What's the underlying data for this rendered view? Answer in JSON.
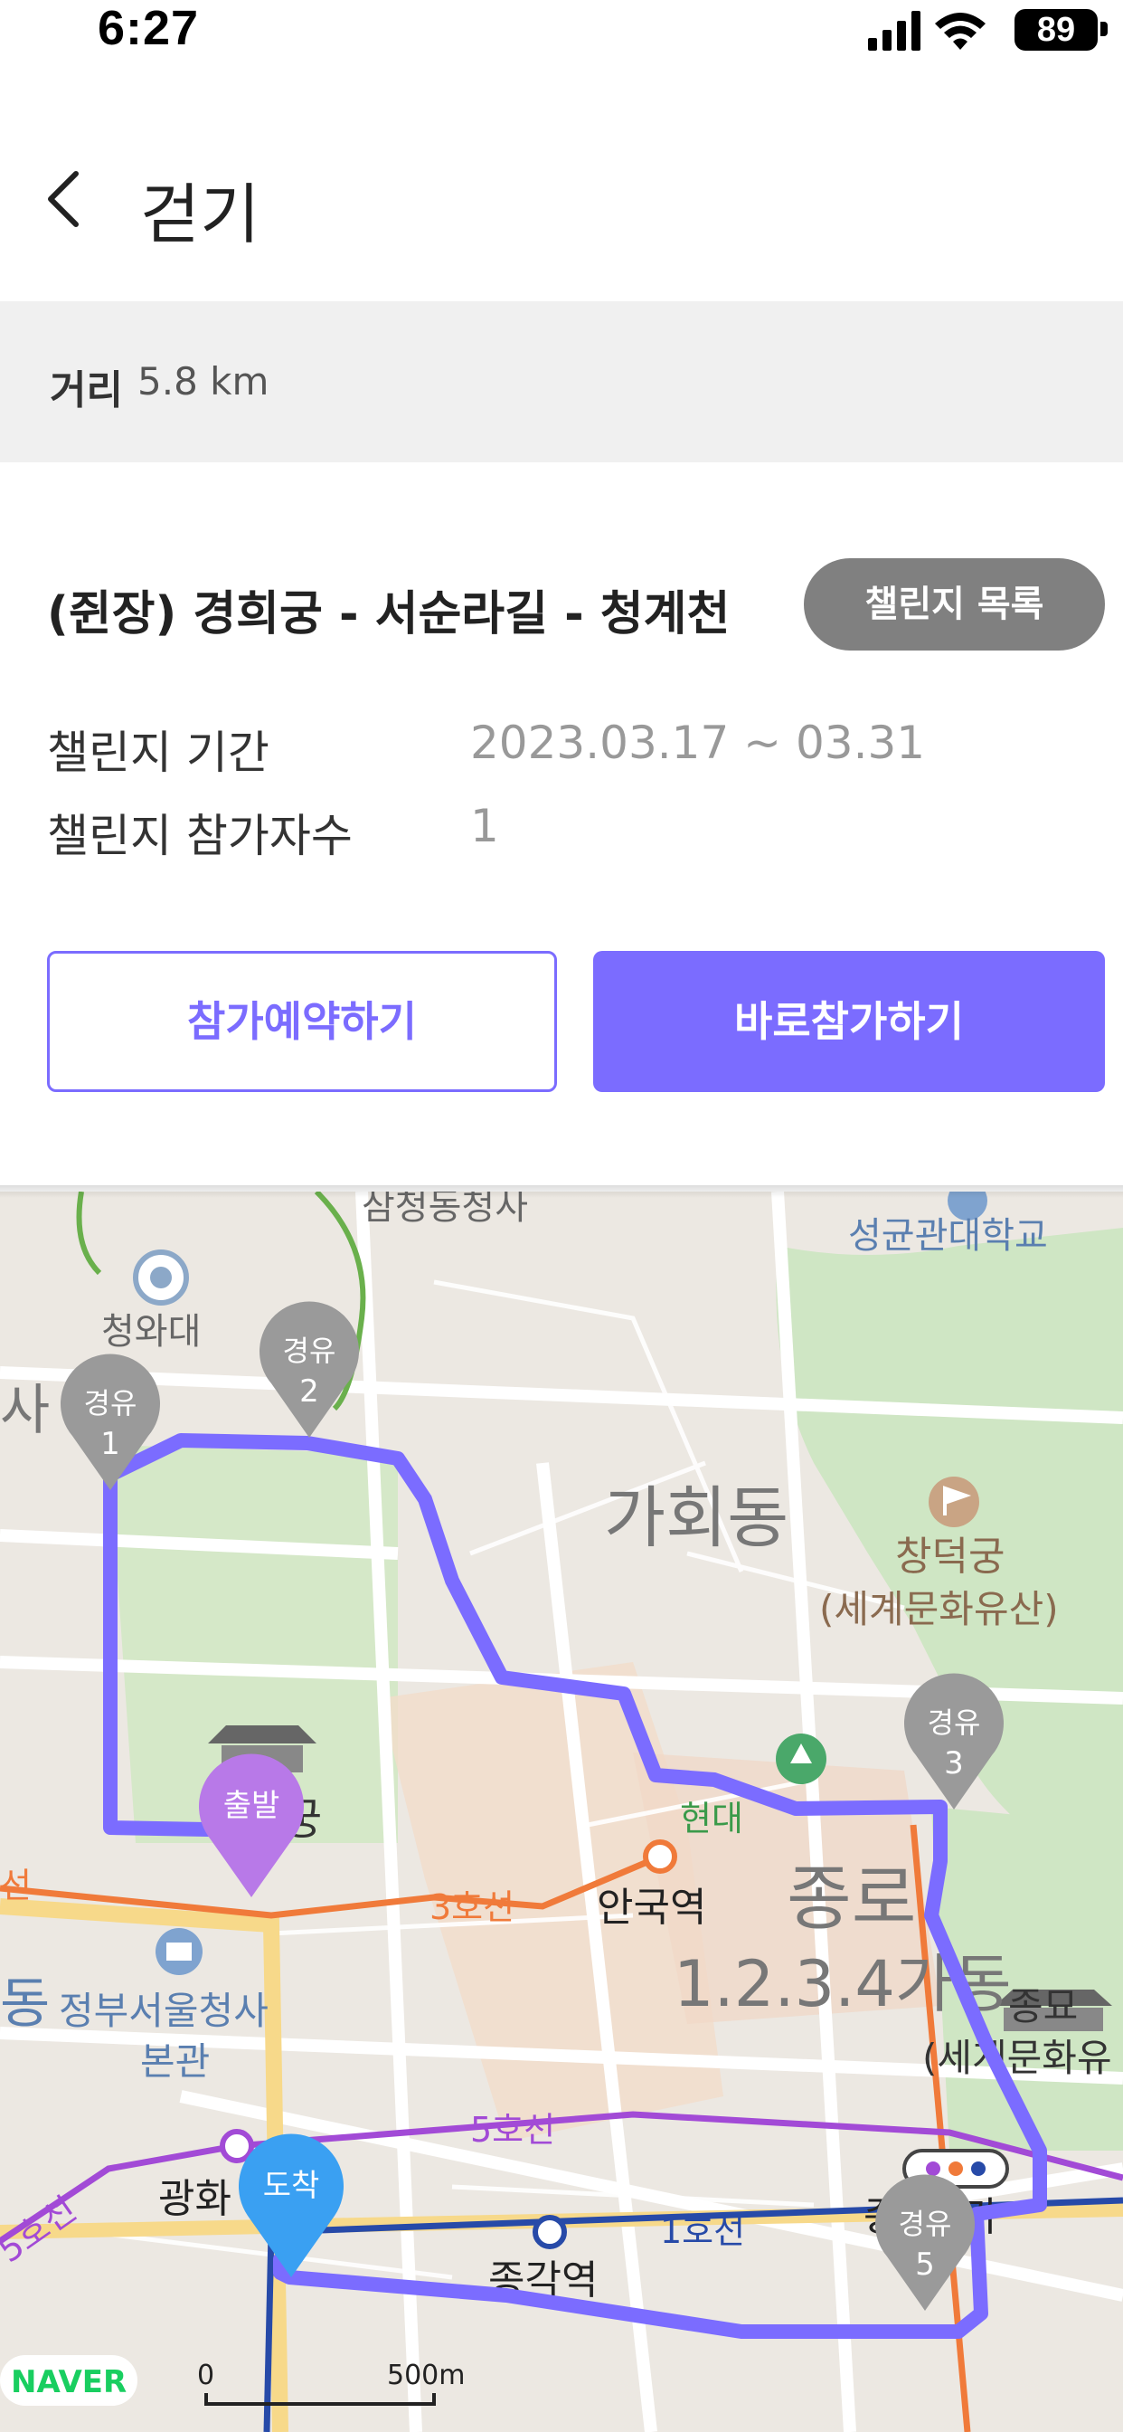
{
  "status_bar": {
    "time": "6:27",
    "battery": "89"
  },
  "nav": {
    "title": "걷기"
  },
  "distance": {
    "label": "거리",
    "value": "5.8 km"
  },
  "course": {
    "title": "(쥔장) 경희궁 - 서순라길 - 청계천",
    "list_button": "챌린지 목록"
  },
  "info": {
    "period_label": "챌린지 기간",
    "period_value": "2023.03.17 ~ 03.31",
    "participants_label": "챌린지 참가자수",
    "participants_value": "1"
  },
  "buttons": {
    "reserve": "참가예약하기",
    "join": "바로참가하기"
  },
  "map": {
    "places": {
      "samcheong": "삼청동청사",
      "skku": "성균관대학교",
      "cheongwadae": "청와대",
      "gahoe": "가회동",
      "changdeok1": "창덕궁",
      "changdeok2": "(세계문화유산)",
      "hyundai": "현대",
      "anguk": "안국역",
      "jongno": "종로",
      "jongno_dong": "1.2.3.4가동",
      "jongmyo1": "종묘",
      "jongmyo2": "(세계문화유",
      "gov1": "정부서울청사",
      "gov2": "본관",
      "gwanghwa": "광화",
      "jonggak": "종각역",
      "jongno3": "종로3가",
      "gung": "궁",
      "sa": "사",
      "dong": "동"
    },
    "lines": {
      "line3": "3호선",
      "line5": "5호선",
      "line5b": "5호선",
      "line1": "1호선",
      "line_left": "선"
    },
    "markers": {
      "start": "출발",
      "end": "도착",
      "wp_label": "경유",
      "wp1": "1",
      "wp2": "2",
      "wp3": "3",
      "wp5": "5"
    },
    "logo": "NAVER",
    "scale_zero": "0",
    "scale_label": "500m"
  },
  "colors": {
    "accent": "#7b6cff",
    "route": "#7b6cff",
    "start_marker": "#b879e8",
    "end_marker": "#3aa0f2",
    "waypoint": "#9a9a9a"
  }
}
